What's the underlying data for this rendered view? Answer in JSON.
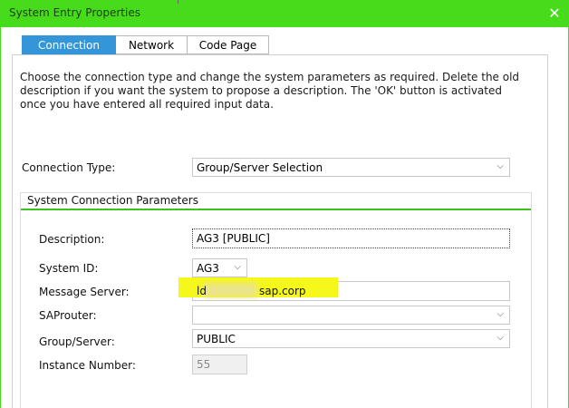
{
  "window": {
    "title": "System Entry Properties",
    "close_icon": "close-icon",
    "accent_color": "#46dc1c"
  },
  "tabs": [
    {
      "label": "Connection",
      "active": true
    },
    {
      "label": "Network",
      "active": false
    },
    {
      "label": "Code Page",
      "active": false
    }
  ],
  "description": "Choose the connection type and change the system parameters as required. Delete the old description if you want the system to propose a description. The 'OK' button is activated once you have entered all required input data.",
  "connection_type": {
    "label": "Connection Type:",
    "value": "Group/Server Selection"
  },
  "group": {
    "title": "System Connection Parameters",
    "fields": {
      "description": {
        "label": "Description:",
        "value": "AG3 [PUBLIC]"
      },
      "system_id": {
        "label": "System ID:",
        "value": "AG3"
      },
      "message_server": {
        "label": "Message Server:",
        "value_prefix": "ld",
        "value_suffix": "sap.corp"
      },
      "saprouter": {
        "label": "SAProuter:",
        "value": ""
      },
      "group_server": {
        "label": "Group/Server:",
        "value": "PUBLIC"
      },
      "instance_number": {
        "label": "Instance Number:",
        "value": "55"
      }
    }
  }
}
